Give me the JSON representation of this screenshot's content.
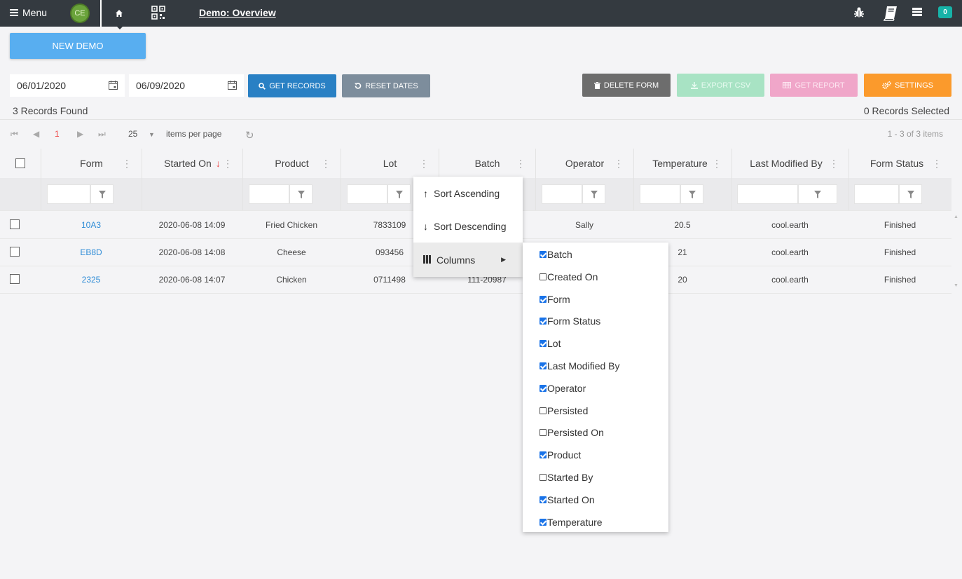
{
  "topbar": {
    "menu_label": "Menu",
    "avatar_initials": "CE",
    "page_link": "Demo: Overview",
    "notification_count": "0"
  },
  "actions": {
    "new_demo": "NEW DEMO",
    "get_records": "GET RECORDS",
    "reset_dates": "RESET DATES",
    "delete_form": "DELETE FORM",
    "export_csv": "EXPORT CSV",
    "get_report": "GET REPORT",
    "settings": "SETTINGS"
  },
  "dates": {
    "start": "06/01/2020",
    "end": "06/09/2020"
  },
  "summary": {
    "records_found": "3 Records Found",
    "records_selected": "0 Records Selected"
  },
  "pager": {
    "page": "1",
    "page_size": "25",
    "items_per_page_label": "items per page",
    "info": "1 - 3 of 3 items"
  },
  "columns": [
    "Form",
    "Started On",
    "Product",
    "Lot",
    "Batch",
    "Operator",
    "Temperature",
    "Last Modified By",
    "Form Status"
  ],
  "rows": [
    {
      "form": "10A3",
      "started_on": "2020-06-08 14:09",
      "product": "Fried Chicken",
      "lot": "7833109",
      "batch": "",
      "operator": "Sally",
      "temperature": "20.5",
      "last_modified_by": "cool.earth",
      "form_status": "Finished"
    },
    {
      "form": "EB8D",
      "started_on": "2020-06-08 14:08",
      "product": "Cheese",
      "lot": "093456",
      "batch": "",
      "operator": "",
      "temperature": "21",
      "last_modified_by": "cool.earth",
      "form_status": "Finished"
    },
    {
      "form": "2325",
      "started_on": "2020-06-08 14:07",
      "product": "Chicken",
      "lot": "0711498",
      "batch": "111-20987",
      "operator": "",
      "temperature": "20",
      "last_modified_by": "cool.earth",
      "form_status": "Finished"
    }
  ],
  "column_menu": {
    "sort_ascending": "Sort Ascending",
    "sort_descending": "Sort Descending",
    "columns": "Columns"
  },
  "column_options": [
    {
      "label": "Batch",
      "checked": true
    },
    {
      "label": "Created On",
      "checked": false
    },
    {
      "label": "Form",
      "checked": true
    },
    {
      "label": "Form Status",
      "checked": true
    },
    {
      "label": "Lot",
      "checked": true
    },
    {
      "label": "Last Modified By",
      "checked": true
    },
    {
      "label": "Operator",
      "checked": true
    },
    {
      "label": "Persisted",
      "checked": false
    },
    {
      "label": "Persisted On",
      "checked": false
    },
    {
      "label": "Product",
      "checked": true
    },
    {
      "label": "Started By",
      "checked": false
    },
    {
      "label": "Started On",
      "checked": true
    },
    {
      "label": "Temperature",
      "checked": true
    }
  ],
  "colors": {
    "primary": "#2980c4",
    "settings": "#fb9a2c",
    "link": "#2d8bd6",
    "sort_indicator": "#e44"
  }
}
